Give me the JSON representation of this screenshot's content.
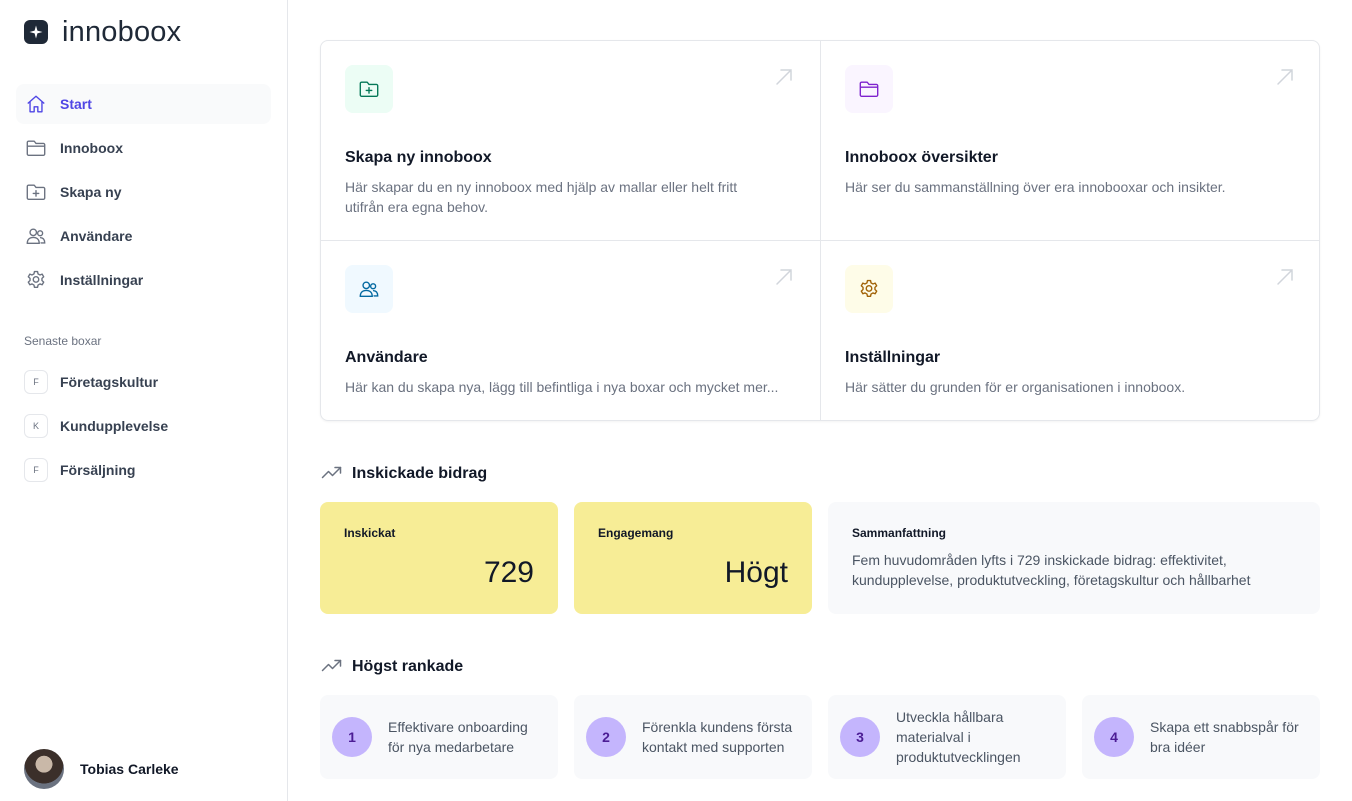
{
  "brand": {
    "name": "innoboox"
  },
  "sidebar": {
    "nav": [
      {
        "label": "Start",
        "icon": "home-icon",
        "active": true
      },
      {
        "label": "Innoboox",
        "icon": "folder-icon"
      },
      {
        "label": "Skapa ny",
        "icon": "folder-plus-icon"
      },
      {
        "label": "Användare",
        "icon": "users-icon"
      },
      {
        "label": "Inställningar",
        "icon": "gear-icon"
      }
    ],
    "recent_title": "Senaste boxar",
    "recent": [
      {
        "initial": "F",
        "label": "Företagskultur"
      },
      {
        "initial": "K",
        "label": "Kundupplevelse"
      },
      {
        "initial": "F",
        "label": "Försäljning"
      }
    ],
    "user": {
      "name": "Tobias Carleke"
    }
  },
  "cards": [
    {
      "title": "Skapa ny innoboox",
      "desc": "Här skapar du en ny innoboox med hjälp av mallar eller helt fritt utifrån era egna behov.",
      "icon": "folder-plus-icon",
      "icon_bg": "#ecfdf5",
      "icon_color": "#047857"
    },
    {
      "title": "Innoboox översikter",
      "desc": "Här ser du sammanställning över era innobooxar och insikter.",
      "icon": "folder-icon",
      "icon_bg": "#faf5ff",
      "icon_color": "#7e22ce"
    },
    {
      "title": "Användare",
      "desc": "Här kan du skapa nya, lägg till befintliga i nya boxar och mycket mer...",
      "icon": "users-icon",
      "icon_bg": "#f0f9ff",
      "icon_color": "#0369a1"
    },
    {
      "title": "Inställningar",
      "desc": "Här sätter du grunden för er organisationen i innoboox.",
      "icon": "gear-icon",
      "icon_bg": "#fefce8",
      "icon_color": "#a16207"
    }
  ],
  "submitted": {
    "title": "Inskickade bidrag",
    "stats": [
      {
        "label": "Inskickat",
        "value": "729"
      },
      {
        "label": "Engagemang",
        "value": "Högt"
      }
    ],
    "summary": {
      "label": "Sammanfattning",
      "text": "Fem huvudområden lyfts i 729 inskickade bidrag: effektivitet, kundupplevelse, produktutveckling, företagskultur och hållbarhet"
    }
  },
  "ranked": {
    "title": "Högst rankade",
    "items": [
      {
        "num": "1",
        "text": "Effektivare onboarding för nya medarbetare"
      },
      {
        "num": "2",
        "text": "Förenkla kundens första kontakt med supporten"
      },
      {
        "num": "3",
        "text": "Utveckla hållbara materialval i produktutvecklingen"
      },
      {
        "num": "4",
        "text": "Skapa ett snabbspår för bra idéer"
      }
    ]
  },
  "colors": {
    "accent": "#4f46e5",
    "stat_bg": "#f7ed96",
    "rank_badge": "#c4b5fd"
  }
}
